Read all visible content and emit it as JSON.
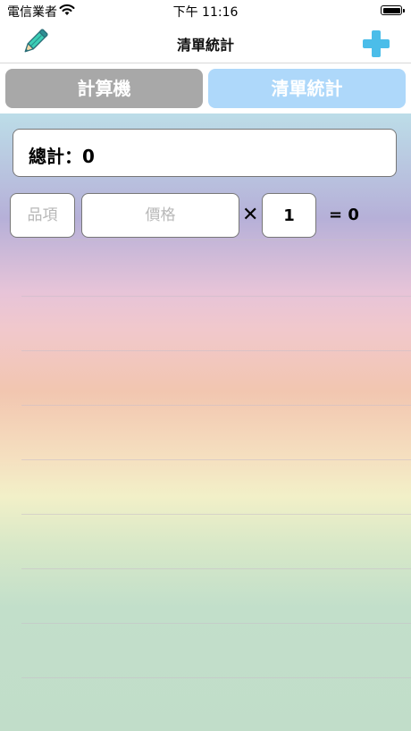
{
  "status": {
    "carrier": "電信業者",
    "time": "下午 11:16",
    "wifi_icon": "wifi-icon",
    "battery_icon": "battery-icon"
  },
  "nav": {
    "title": "清單統計",
    "left_icon": "pencil-icon",
    "right_icon": "plus-icon"
  },
  "tabs": [
    {
      "label": "計算機",
      "selected": false,
      "color": "#a8a8a8"
    },
    {
      "label": "清單統計",
      "selected": true,
      "color": "#aed8fa"
    }
  ],
  "total": {
    "text": "總計：0"
  },
  "row": {
    "item_placeholder": "品項",
    "price_placeholder": "價格",
    "times_symbol": "✕",
    "quantity": "1",
    "result": "= 0"
  },
  "colors": {
    "accent_plus": "#4bbde9",
    "pencil": "#3ccfb6",
    "tab_inactive": "#a8a8a8",
    "tab_active": "#aed8fa"
  }
}
